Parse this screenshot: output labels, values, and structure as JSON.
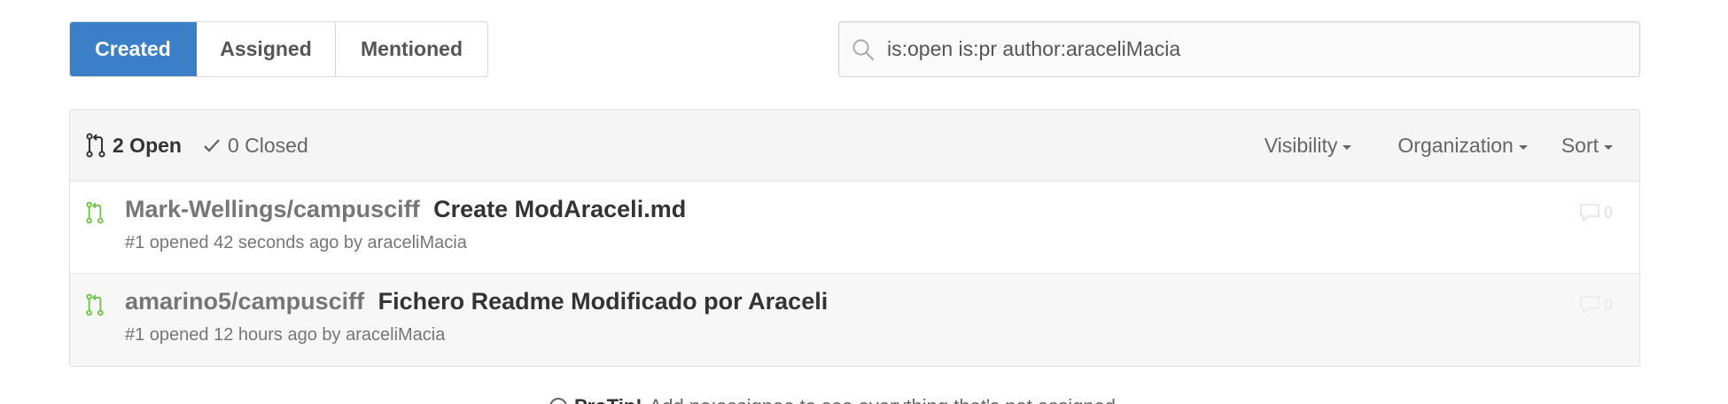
{
  "tabs": [
    {
      "label": "Created",
      "active": true
    },
    {
      "label": "Assigned",
      "active": false
    },
    {
      "label": "Mentioned",
      "active": false
    }
  ],
  "search": {
    "value": "is:open is:pr author:araceliMacia",
    "icon": "search-icon"
  },
  "states": {
    "open_label": "2 Open",
    "closed_label": "0 Closed"
  },
  "filters": {
    "visibility": "Visibility",
    "organization": "Organization",
    "sort": "Sort"
  },
  "pull_requests": [
    {
      "repo": "Mark-Wellings/campusciff",
      "title": "Create ModAraceli.md",
      "meta": "#1 opened 42 seconds ago by araceliMacia",
      "comments": "0"
    },
    {
      "repo": "amarino5/campusciff",
      "title": "Fichero Readme Modificado por Araceli",
      "meta": "#1 opened 12 hours ago by araceliMacia",
      "comments": "0"
    }
  ],
  "footer": {
    "tip_bold": "ProTip!",
    "tip_text": "Add no:assignee to see everything that's not assigned."
  },
  "colors": {
    "accent": "#3b7fc8",
    "open_green": "#6cc644"
  }
}
